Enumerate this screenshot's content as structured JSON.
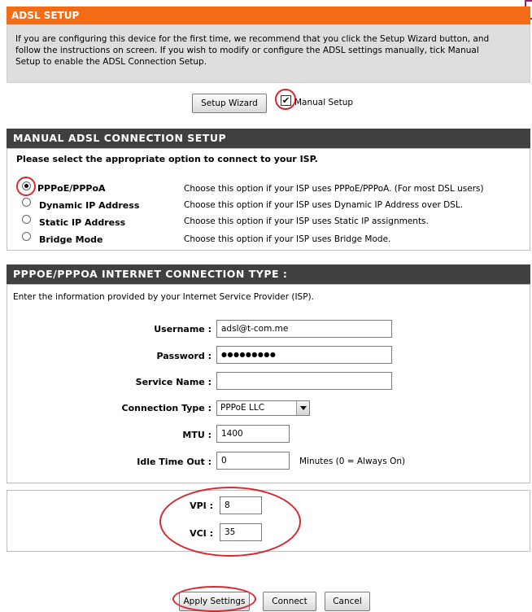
{
  "adsl_setup": {
    "title": "ADSL SETUP",
    "description_line1": "If you are configuring this device for the first time, we recommend that you click the Setup Wizard button, and",
    "description_line2": "follow the instructions on screen. If you wish to modify or configure the ADSL settings manually, tick Manual",
    "description_line3": "Setup to enable the ADSL Connection Setup.",
    "setup_wizard_label": "Setup Wizard",
    "manual_setup_label": "Manual Setup",
    "manual_setup_checked": true
  },
  "manual_section": {
    "title": "MANUAL ADSL CONNECTION SETUP",
    "prompt": "Please select the appropriate option to connect to your ISP.",
    "options": [
      {
        "label": "PPPoE/PPPoA",
        "desc": "Choose this option if your ISP uses PPPoE/PPPoA. (For most DSL users)",
        "selected": true
      },
      {
        "label": "Dynamic IP Address",
        "desc": "Choose this option if your ISP uses Dynamic IP Address over DSL.",
        "selected": false
      },
      {
        "label": "Static IP Address",
        "desc": "Choose this option if your ISP uses Static IP assignments.",
        "selected": false
      },
      {
        "label": "Bridge Mode",
        "desc": "Choose this option if your ISP uses Bridge Mode.",
        "selected": false
      }
    ]
  },
  "pppoe_section": {
    "title": "PPPOE/PPPOA INTERNET CONNECTION TYPE :",
    "intro": "Enter the information provided by your Internet Service Provider (ISP).",
    "username_label": "Username :",
    "username_value": "adsl@t-com.me",
    "password_label": "Password :",
    "password_value": "●●●●●●●●●",
    "service_name_label": "Service Name :",
    "service_name_value": "",
    "connection_type_label": "Connection Type :",
    "connection_type_value": "PPPoE LLC",
    "mtu_label": "MTU :",
    "mtu_value": "1400",
    "idle_label": "Idle Time Out :",
    "idle_value": "0",
    "idle_hint": "Minutes (0 = Always On)"
  },
  "vpi_vci": {
    "vpi_label": "VPI :",
    "vpi_value": "8",
    "vci_label": "VCI :",
    "vci_value": "35"
  },
  "footer_buttons": {
    "apply": "Apply Settings",
    "connect": "Connect",
    "cancel": "Cancel"
  },
  "colors": {
    "header_orange": "#f36b14",
    "section_dark": "#404040",
    "highlight_red": "#d8282e"
  }
}
